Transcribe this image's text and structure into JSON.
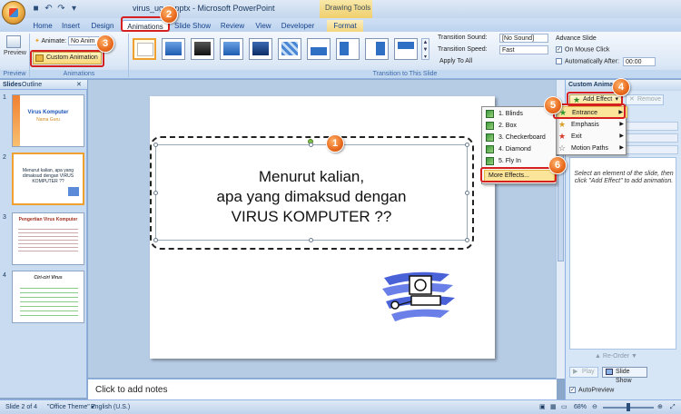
{
  "window": {
    "title": "virus_ug... .pptx - Microsoft PowerPoint",
    "contextual_tab_group": "Drawing Tools"
  },
  "tabs": [
    "Home",
    "Insert",
    "Design",
    "Animations",
    "Slide Show",
    "Review",
    "View",
    "Developer",
    "Format"
  ],
  "active_tab": "Animations",
  "ribbon": {
    "preview": {
      "label": "Preview",
      "group": "Preview"
    },
    "animations_group": {
      "animate_label": "Animate:",
      "animate_value": "No Anim",
      "custom_animation_label": "Custom Animation",
      "group": "Animations"
    },
    "transition_group": {
      "group": "Transition to This Slide",
      "sound_label": "Transition Sound:",
      "sound_value": "[No Sound]",
      "speed_label": "Transition Speed:",
      "speed_value": "Fast",
      "apply_all_label": "Apply To All",
      "advance_label": "Advance Slide",
      "on_click_label": "On Mouse Click",
      "auto_after_label": "Automatically After:",
      "auto_after_value": "00:00"
    }
  },
  "left_pane": {
    "tabs": [
      "Slides",
      "Outline"
    ],
    "thumbnails": [
      {
        "num": "1",
        "title": "Virus Komputer",
        "sub": "Nama Guru"
      },
      {
        "num": "2",
        "title": "Menurut kalian, apa yang dimaksud dengan VIRUS KOMPUTER ??",
        "sub": ""
      },
      {
        "num": "3",
        "title": "Pengertian Virus Komputer",
        "sub": ""
      },
      {
        "num": "4",
        "title": "Ciri-ciri Virus",
        "sub": ""
      }
    ]
  },
  "slide": {
    "title_line1": "Menurut kalian,",
    "title_line2": "apa yang dimaksud dengan",
    "title_line3": "VIRUS KOMPUTER ??"
  },
  "notes_placeholder": "Click to add notes",
  "status": {
    "slide_info": "Slide 2 of 4",
    "theme": "\"Office Theme\"",
    "language": "English (U.S.)",
    "zoom": "68%"
  },
  "task_pane": {
    "title": "Custom Animation",
    "add_effect": "Add Effect",
    "remove": "Remove",
    "hint": "Select an element of the slide, then click \"Add Effect\" to add animation.",
    "reorder": "Re-Order",
    "play": "Play",
    "slide_show": "Slide Show",
    "autopreview": "AutoPreview"
  },
  "add_effect_menu": [
    {
      "label": "Entrance",
      "highlighted": true
    },
    {
      "label": "Emphasis",
      "highlighted": false
    },
    {
      "label": "Exit",
      "highlighted": false
    },
    {
      "label": "Motion Paths",
      "highlighted": false
    }
  ],
  "entrance_submenu": [
    {
      "label": "1. Blinds"
    },
    {
      "label": "2. Box"
    },
    {
      "label": "3. Checkerboard"
    },
    {
      "label": "4. Diamond"
    },
    {
      "label": "5. Fly In"
    }
  ],
  "more_effects": "More Effects...",
  "callouts": [
    "1",
    "2",
    "3",
    "4",
    "5",
    "6"
  ],
  "colors": {
    "callout": "#e86a1e",
    "highlight_box": "#d61f1f",
    "menu_highlight": "#fbe59a"
  }
}
